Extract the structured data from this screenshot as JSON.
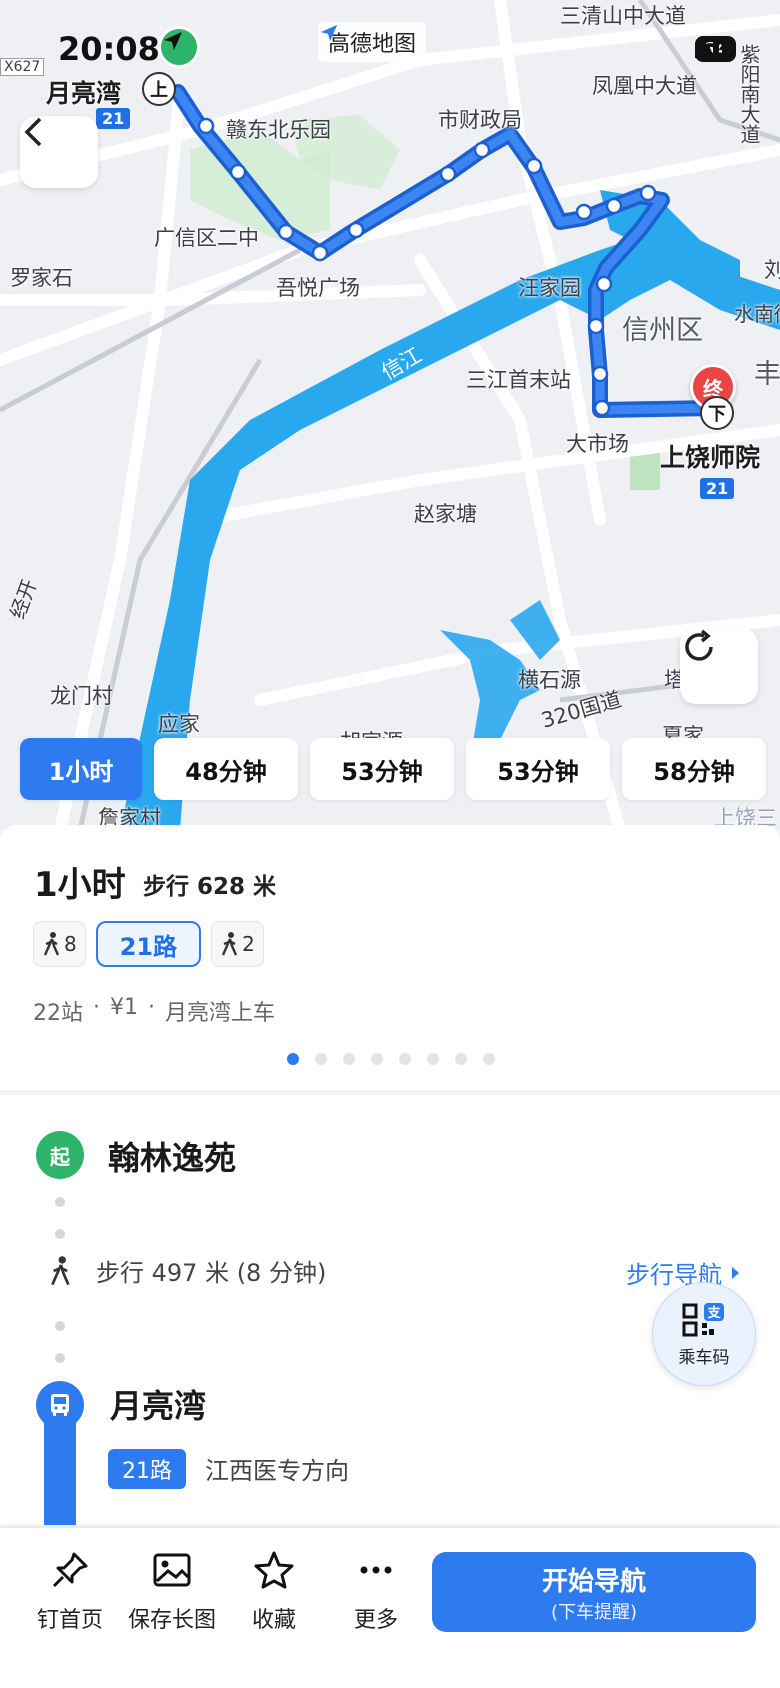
{
  "status_bar": {
    "time": "20:08",
    "battery": "64",
    "app_name": "高德地图"
  },
  "map": {
    "labels": {
      "top_road": "三清山中大道",
      "fenghuang": "凤凰中大道",
      "ziyang": "紫阳南大道",
      "k627": "X627",
      "ganbei": "赣东北乐园",
      "shicaizheng": "市财政局",
      "guangxin": "广信区二中",
      "luojiashi": "罗家石",
      "wuyue": "吾悦广场",
      "wangjiayuan": "汪家园",
      "xinzhou": "信州区",
      "shuinan": "水南街",
      "xinjiang": "信江",
      "sanjiang": "三江首末站",
      "dashichang": "大市场",
      "zhaojiatang": "赵家塘",
      "longmen": "龙门村",
      "yingjia": "应家",
      "hengshiyuan": "横石源",
      "road320": "320国道",
      "zhanjia": "詹家村",
      "shangrao_short": "上饶三",
      "hujiayuan": "胡家源",
      "xiajia": "夏家",
      "jing": "经开",
      "ta": "塔",
      "shou": "丰",
      "dui": "刘"
    },
    "origin_label": "月亮湾",
    "origin_marker": "上",
    "origin_route": "21",
    "dest_label": "上饶师院",
    "dest_marker": "下",
    "dest_route": "21",
    "start_pin": "起",
    "end_pin": "终"
  },
  "tabs": [
    "1小时",
    "48分钟",
    "53分钟",
    "53分钟",
    "58分钟"
  ],
  "summary": {
    "title": "1小时",
    "walk": "步行 628 米",
    "chips": {
      "walk_before": "8",
      "route": "21路",
      "walk_after": "2"
    },
    "meta": [
      "22站",
      "·",
      "¥1",
      "·",
      "月亮湾上车"
    ],
    "page_dots": 8,
    "active_dot": 0
  },
  "detail": {
    "start_badge": "起",
    "start_name": "翰林逸苑",
    "walk_text": "步行 497 米 (8 分钟)",
    "walk_nav": "步行导航",
    "stop_name": "月亮湾",
    "route_tag": "21路",
    "direction": "江西医专方向",
    "qr_label": "乘车码"
  },
  "bottom": {
    "pin": "钉首页",
    "save": "保存长图",
    "favorite": "收藏",
    "more": "更多",
    "start_nav": "开始导航",
    "start_nav_sub": "(下车提醒)"
  },
  "colors": {
    "accent": "#2e7bf0",
    "route": "#1f6fe5",
    "water": "#2aa8ee",
    "green": "#2db36a",
    "end_red": "#e94545"
  }
}
